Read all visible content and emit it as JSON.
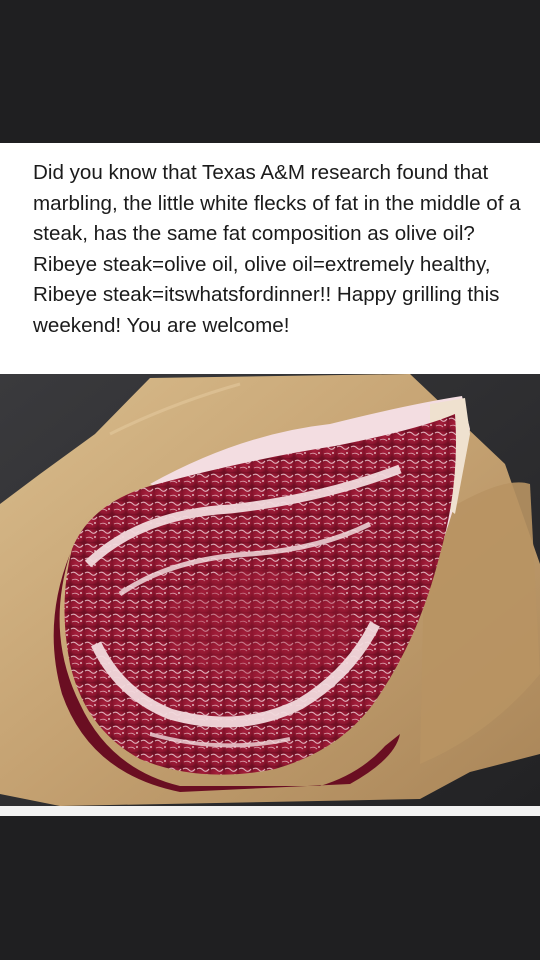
{
  "post": {
    "text": "Did you know that Texas A&M research found that marbling, the little white flecks of fat in the middle of a steak, has the same fat composition as olive oil? Ribeye steak=olive oil, olive oil=extremely healthy, Ribeye steak=itswhatsfordinner!! Happy grilling this weekend! You are welcome!"
  },
  "colors": {
    "background": "#1f1f21",
    "card": "#ffffff",
    "meat": "#9b1c35",
    "fat": "#f1d9dc",
    "paper": "#c8a978"
  }
}
